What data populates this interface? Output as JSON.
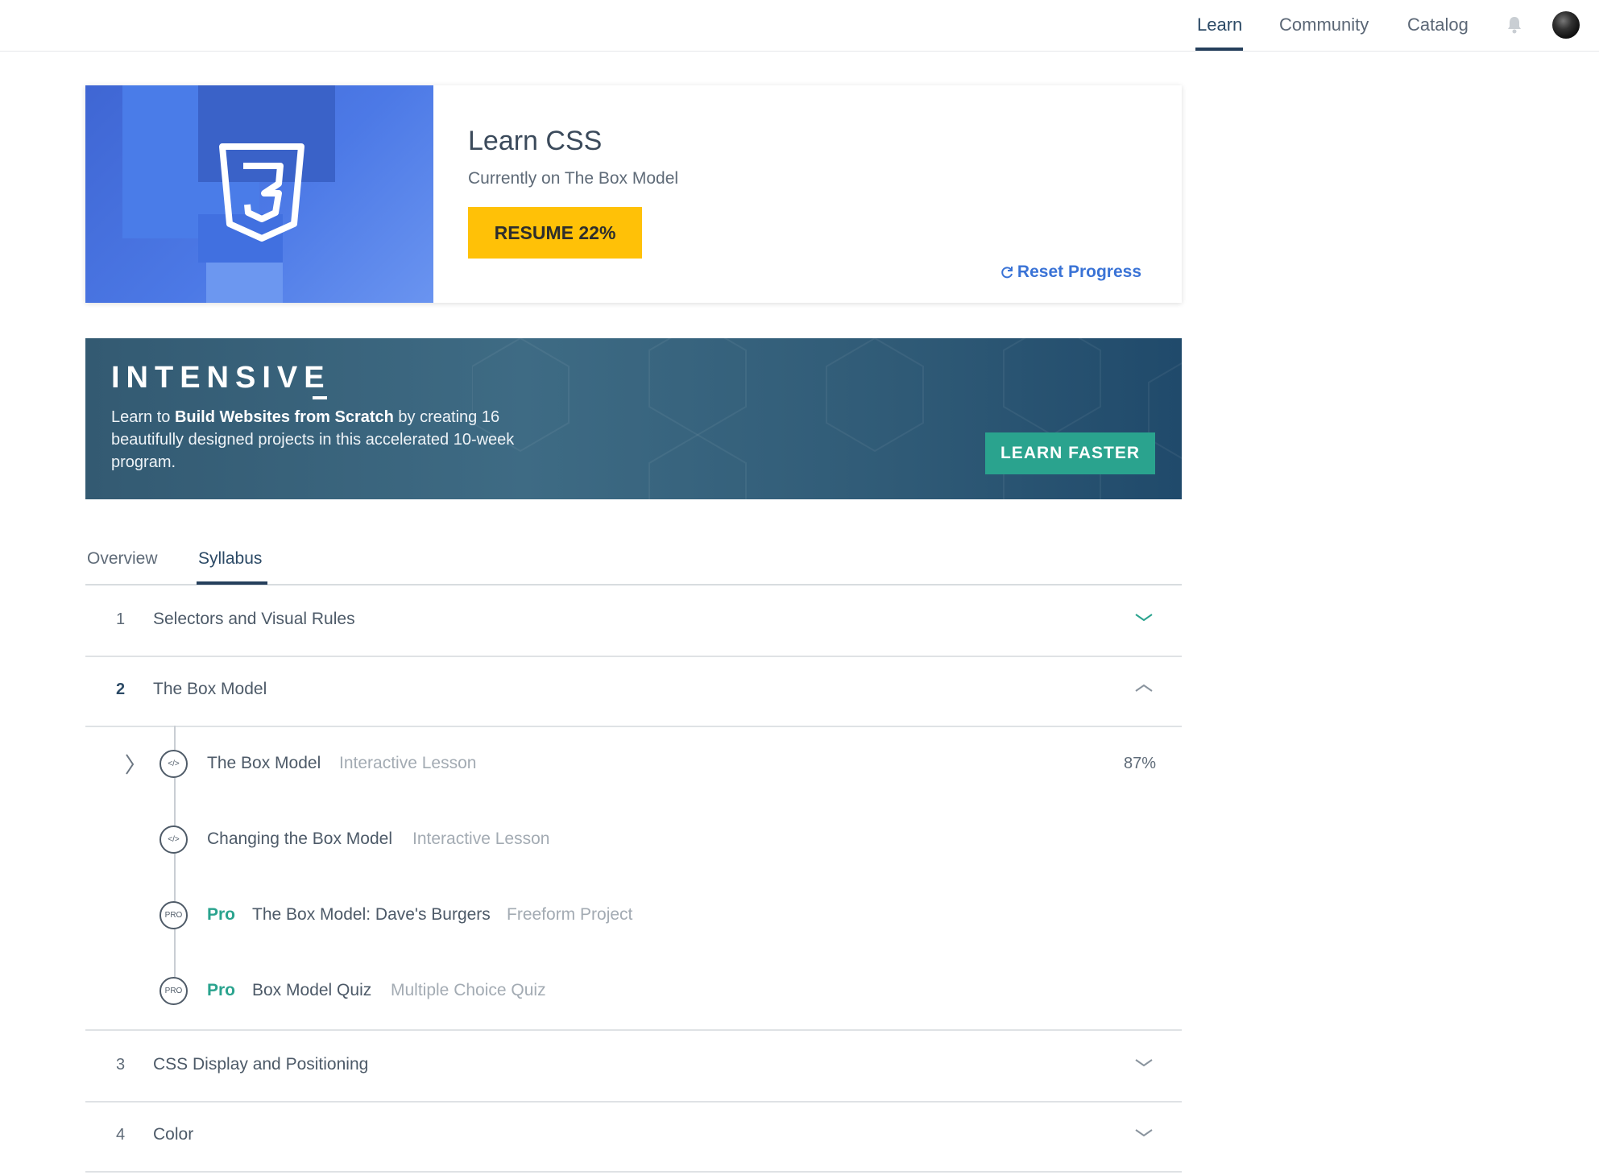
{
  "nav": {
    "items": [
      {
        "label": "Learn",
        "active": true
      },
      {
        "label": "Community",
        "active": false
      },
      {
        "label": "Catalog",
        "active": false
      }
    ],
    "icons": [
      "bell-icon",
      "avatar"
    ]
  },
  "course": {
    "title": "Learn CSS",
    "current": "Currently on The Box Model",
    "resume_label": "RESUME 22%",
    "reset_label": "Reset Progress",
    "logo_glyph": "3",
    "accent_color": "#ffc107"
  },
  "banner": {
    "title": "INTENSIVE",
    "text_prefix": "Learn to ",
    "text_bold": "Build Websites from Scratch",
    "text_suffix": " by creating 16 beautifully designed projects in this accelerated 10-week program.",
    "button_label": "LEARN FASTER",
    "button_color": "#2aa38e"
  },
  "tabs": [
    {
      "label": "Overview",
      "active": false
    },
    {
      "label": "Syllabus",
      "active": true
    }
  ],
  "syllabus": {
    "sections": [
      {
        "number": "1",
        "title": "Selectors and Visual Rules",
        "expanded": false
      },
      {
        "number": "2",
        "title": "The Box Model",
        "expanded": true
      },
      {
        "number": "3",
        "title": "CSS Display and Positioning",
        "expanded": false
      },
      {
        "number": "4",
        "title": "Color",
        "expanded": false
      }
    ],
    "lessons": [
      {
        "icon": "code-icon",
        "pro": "",
        "title": "The Box Model",
        "type": "Interactive Lesson",
        "progress": "87%"
      },
      {
        "icon": "code-icon",
        "pro": "",
        "title": "Changing the Box Model",
        "type": "Interactive Lesson",
        "progress": ""
      },
      {
        "icon": "pro-icon",
        "icon_text": "PRO",
        "pro": "Pro",
        "title": "The Box Model: Dave's Burgers",
        "type": "Freeform Project",
        "progress": ""
      },
      {
        "icon": "pro-icon",
        "icon_text": "PRO",
        "pro": "Pro",
        "title": "Box Model Quiz",
        "type": "Multiple Choice Quiz",
        "progress": ""
      }
    ]
  }
}
